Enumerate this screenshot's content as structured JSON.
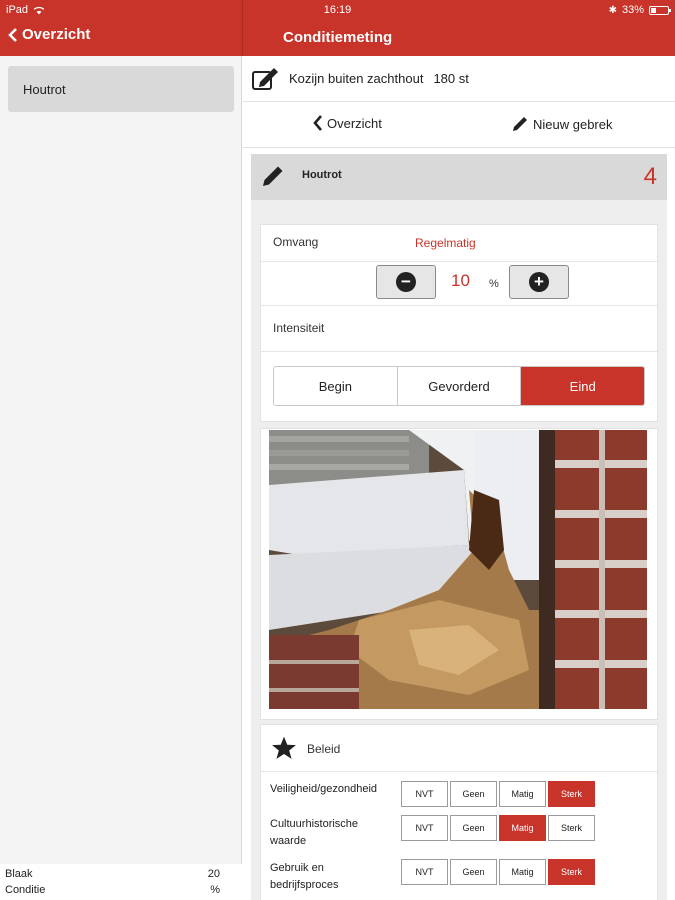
{
  "status": {
    "device": "iPad",
    "time": "16:19",
    "battery": "33%"
  },
  "nav": {
    "back_label": "Overzicht",
    "title": "Conditiemeting"
  },
  "sidebar": {
    "items": [
      {
        "label": "Houtrot"
      }
    ],
    "footer": [
      {
        "label": "Blaak",
        "value": "20"
      },
      {
        "label": "Conditie",
        "value": "%"
      }
    ]
  },
  "object": {
    "title": "Kozijn buiten zachthout",
    "count": "180 st"
  },
  "subnav": {
    "back_label": "Overzicht",
    "new_label": "Nieuw gebrek"
  },
  "defect": {
    "title": "Houtrot",
    "number": "4",
    "omvang_label": "Omvang",
    "omvang_value": "Regelmatig",
    "percent": "10",
    "percent_unit": "%",
    "intensiteit_label": "Intensiteit",
    "intensity_options": [
      "Begin",
      "Gevorderd",
      "Eind"
    ],
    "intensity_selected": "Eind"
  },
  "beleid": {
    "title": "Beleid",
    "options": [
      "NVT",
      "Geen",
      "Matig",
      "Sterk"
    ],
    "criteria": [
      {
        "label": "Veiligheid/gezondheid",
        "selected": "Sterk"
      },
      {
        "label": "Cultuurhistorische waarde",
        "selected": "Matig"
      },
      {
        "label": "Gebruik en bedrijfsproces",
        "selected": "Sterk"
      }
    ]
  },
  "colors": {
    "accent": "#c8332a",
    "panel": "#eeeeee",
    "header_gray": "#d9d9d9"
  },
  "icons": {
    "edit": "pencil-square-icon",
    "pencil": "pencil-icon",
    "star": "star-icon",
    "back": "chevron-left-icon"
  }
}
